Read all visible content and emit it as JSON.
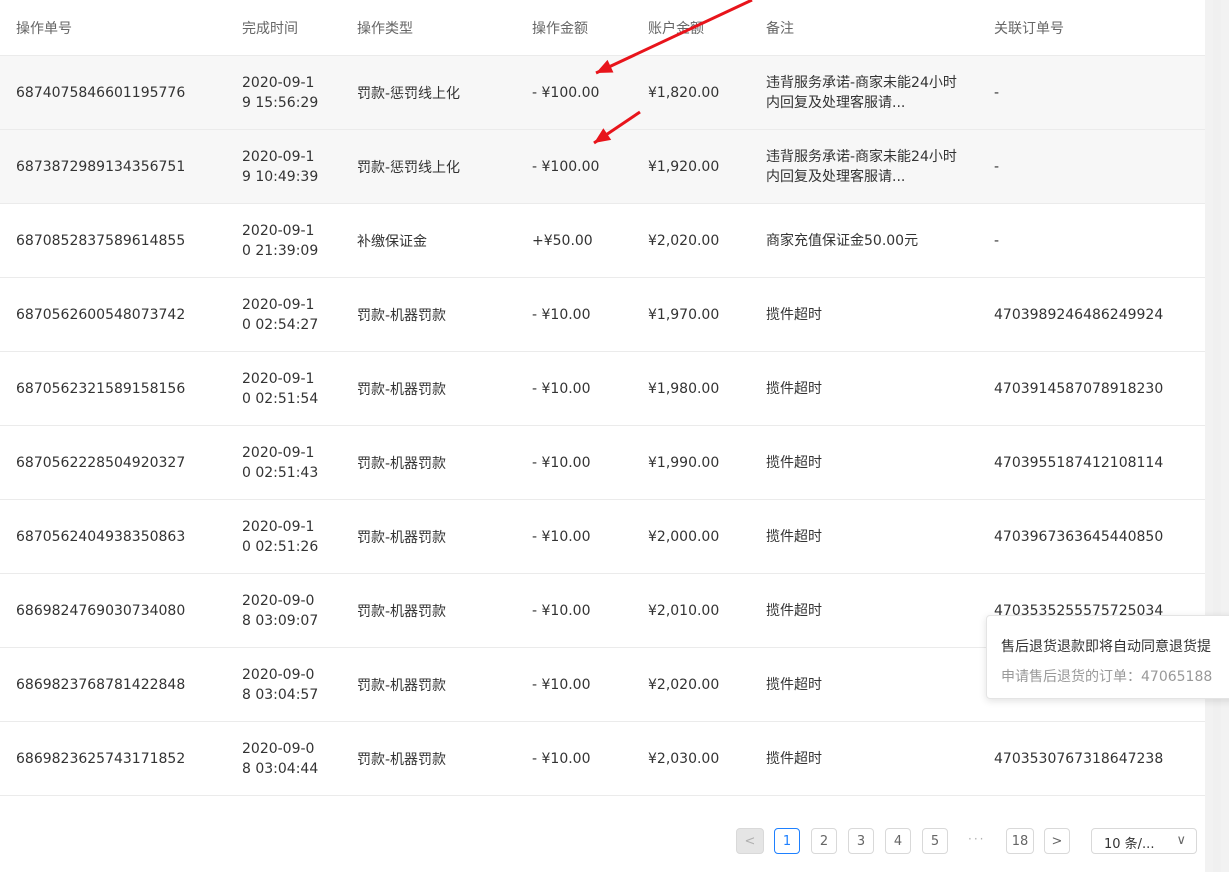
{
  "columns": {
    "id": "操作单号",
    "time": "完成时间",
    "type": "操作类型",
    "amount": "操作金额",
    "balance": "账户金额",
    "remark": "备注",
    "order": "关联订单号"
  },
  "rows": [
    {
      "id": "6874075846601195776",
      "time": "2020-09-19 15:56:29",
      "type": "罚款-惩罚线上化",
      "amount": "- ¥100.00",
      "balance": "¥1,820.00",
      "remark": "违背服务承诺-商家未能24小时内回复及处理客服请...",
      "order": "-"
    },
    {
      "id": "6873872989134356751",
      "time": "2020-09-19 10:49:39",
      "type": "罚款-惩罚线上化",
      "amount": "- ¥100.00",
      "balance": "¥1,920.00",
      "remark": "违背服务承诺-商家未能24小时内回复及处理客服请...",
      "order": "-"
    },
    {
      "id": "6870852837589614855",
      "time": "2020-09-10 21:39:09",
      "type": "补缴保证金",
      "amount": "+¥50.00",
      "balance": "¥2,020.00",
      "remark": "商家充值保证金50.00元",
      "order": "-"
    },
    {
      "id": "6870562600548073742",
      "time": "2020-09-10 02:54:27",
      "type": "罚款-机器罚款",
      "amount": "- ¥10.00",
      "balance": "¥1,970.00",
      "remark": "揽件超时",
      "order": "4703989246486249924"
    },
    {
      "id": "6870562321589158156",
      "time": "2020-09-10 02:51:54",
      "type": "罚款-机器罚款",
      "amount": "- ¥10.00",
      "balance": "¥1,980.00",
      "remark": "揽件超时",
      "order": "4703914587078918230"
    },
    {
      "id": "6870562228504920327",
      "time": "2020-09-10 02:51:43",
      "type": "罚款-机器罚款",
      "amount": "- ¥10.00",
      "balance": "¥1,990.00",
      "remark": "揽件超时",
      "order": "4703955187412108114"
    },
    {
      "id": "6870562404938350863",
      "time": "2020-09-10 02:51:26",
      "type": "罚款-机器罚款",
      "amount": "- ¥10.00",
      "balance": "¥2,000.00",
      "remark": "揽件超时",
      "order": "4703967363645440850"
    },
    {
      "id": "6869824769030734080",
      "time": "2020-09-08 03:09:07",
      "type": "罚款-机器罚款",
      "amount": "- ¥10.00",
      "balance": "¥2,010.00",
      "remark": "揽件超时",
      "order": "4703535255575725034"
    },
    {
      "id": "6869823768781422848",
      "time": "2020-09-08 03:04:57",
      "type": "罚款-机器罚款",
      "amount": "- ¥10.00",
      "balance": "¥2,020.00",
      "remark": "揽件超时",
      "order": ""
    },
    {
      "id": "6869823625743171852",
      "time": "2020-09-08 03:04:44",
      "type": "罚款-机器罚款",
      "amount": "- ¥10.00",
      "balance": "¥2,030.00",
      "remark": "揽件超时",
      "order": "4703530767318647238"
    }
  ],
  "tooltip": {
    "title": "售后退货退款即将自动同意退货提",
    "body": "申请售后退货的订单：47065188"
  },
  "pagination": {
    "prev": "<",
    "pages": [
      "1",
      "2",
      "3",
      "4",
      "5"
    ],
    "ellipsis": "···",
    "last": "18",
    "next": ">",
    "page_size": "10 条/...",
    "page_size_arrow": "∨",
    "current": "1"
  },
  "annotation_color": "#e8141b",
  "active_color": "#1e80ff"
}
